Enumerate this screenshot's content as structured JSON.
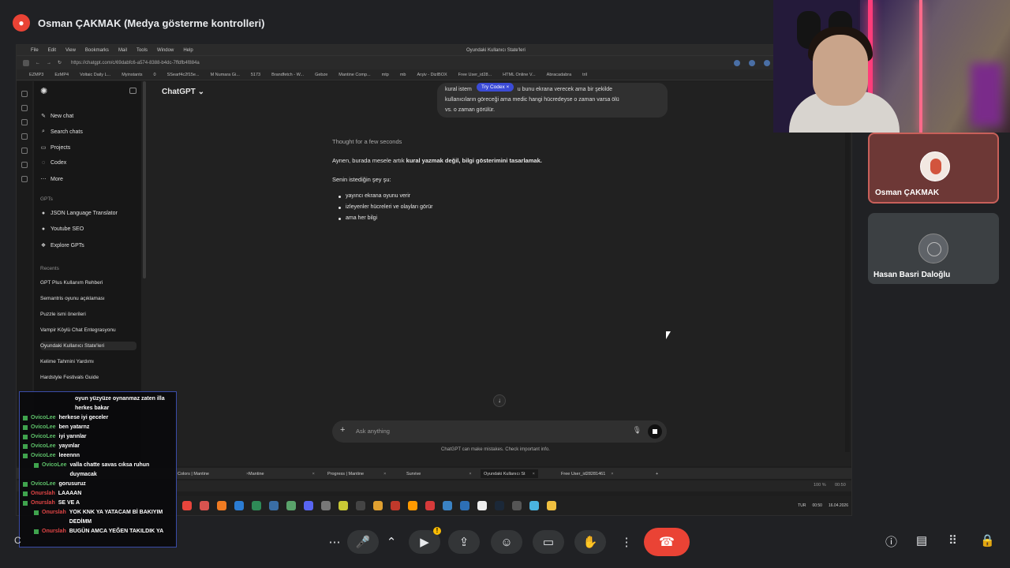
{
  "meet": {
    "presenting_title": "Osman ÇAKMAK (Medya gösterme kontrolleri)",
    "participants": [
      {
        "name": "Osman ÇAKMAK"
      },
      {
        "name": "Hasan Basri Daloğlu"
      }
    ]
  },
  "shared": {
    "mac_menu": [
      "File",
      "Edit",
      "View",
      "Bookmarks",
      "Mail",
      "Tools",
      "Window",
      "Help"
    ],
    "window_title": "Oyundaki Kullanıcı State'leri",
    "url": "https://chatgpt.com/c/69dabfc6-a574-8388-b4dc-7ffdfb4f884a",
    "bookmarks": [
      "EZMP3",
      "EzMP4",
      "Voltaic Daily L...",
      "Myinstants",
      "0",
      "SSearf4c2f15e...",
      "M Numara Gi...",
      "5173",
      "Brandfetch - W...",
      "Gebze",
      "Mantine Comp...",
      "mtp",
      "mb",
      "Arşiv - DizIBOX",
      "Free User_id28...",
      "HTML Online V...",
      "Abracadabra",
      "tril"
    ],
    "chatgpt": {
      "header": "ChatGPT",
      "sidebar_items": [
        "New chat",
        "Search chats",
        "Projects",
        "Codex",
        "More"
      ],
      "gpts_label": "GPTs",
      "gpts": [
        "JSON Language Translator",
        "Youtube SEO",
        "Explore GPTs"
      ],
      "recents_label": "Recents",
      "recents": [
        "GPT Plus Kullanım Rehberi",
        "Semantris oyunu açıklaması",
        "Puzzle ismi önerileri",
        "Vampir Köylü Chat Entegrasyonu",
        "Oyundaki Kullanıcı State'leri",
        "Kelime Tahmini Yardımı",
        "Hardstyle Festivals Guide"
      ],
      "user_message_line1_a": "kural istem",
      "user_message_line1_b": "u bunu ekrana verecek ama bir şekilde",
      "user_message_line2": "kullanıcıların göreceği ama medic hangi hücredeyse o zaman varsa ölü",
      "user_message_line3": "vs. o zaman görülür.",
      "codex_pill": "Try Codex ×",
      "thought": "Thought for a few seconds",
      "answer_line1_plain": "Aynen, burada mesele artık ",
      "answer_line1_bold": "kural yazmak değil, bilgi gösterimini tasarlamak.",
      "answer_line2": "Senin istediğin şey şu:",
      "bullets": [
        "yayıncı ekrana oyunu verir",
        "izleyenler hücreleri ve olayları görür",
        "ama her bilgi"
      ],
      "composer_placeholder": "Ask anything",
      "disclaimer": "ChatGPT can make mistakes. Check important info."
    },
    "tabs": [
      "Colors | Mantine",
      "Mantine",
      "Progress | Mantine",
      "Survive",
      "Oyundaki Kullanıcı St",
      "Free User_id28281461"
    ],
    "status": {
      "zoom": "100 %",
      "time": "00:50"
    },
    "tray": {
      "lang": "TUR",
      "clock": "00:50",
      "date": "16.04.2026"
    }
  },
  "chat_overlay": [
    {
      "user": "",
      "text": "oyun yüzyüze oynanmaz zaten illa herkes bakar",
      "color": "green"
    },
    {
      "user": "OvicoLee",
      "text": "herkese iyi geceler",
      "color": "green"
    },
    {
      "user": "OvicoLee",
      "text": "ben yatarnz",
      "color": "green"
    },
    {
      "user": "OvicoLee",
      "text": "iyi yarınlar",
      "color": "green"
    },
    {
      "user": "OvicoLee",
      "text": "yayınlar",
      "color": "green"
    },
    {
      "user": "OvicoLee",
      "text": "leeennn",
      "color": "green"
    },
    {
      "user": "OvicoLee",
      "text": "valla chatte savas cıksa ruhun duymacak",
      "color": "green"
    },
    {
      "user": "OvicoLee",
      "text": "gorusuruz",
      "color": "green"
    },
    {
      "user": "Onurslah",
      "text": "LAAAAN",
      "color": "red"
    },
    {
      "user": "Onurslah",
      "text": "SE VE A",
      "color": "red"
    },
    {
      "user": "Onurslah",
      "text": "YOK KNK YA YATACAM Bİ BAKIYIM DEDİMM",
      "color": "red"
    },
    {
      "user": "Onurslah",
      "text": "BUGÜN AMCA YEĞEN TAKILDIK YA",
      "color": "red"
    }
  ],
  "accent_colors": {
    "end_call": "#ea4335",
    "active_speaker": "#c8605a",
    "overlay_border": "#3a4ca8"
  },
  "controls": [
    "more-options-icon",
    "mic-icon",
    "chevron-up-icon",
    "camera-icon",
    "present-icon",
    "emoji-icon",
    "captions-icon",
    "raise-hand-icon",
    "more-vert-icon",
    "end-call-icon"
  ],
  "right_controls": [
    "info-icon",
    "chat-icon",
    "apps-icon",
    "lock-person-icon"
  ]
}
